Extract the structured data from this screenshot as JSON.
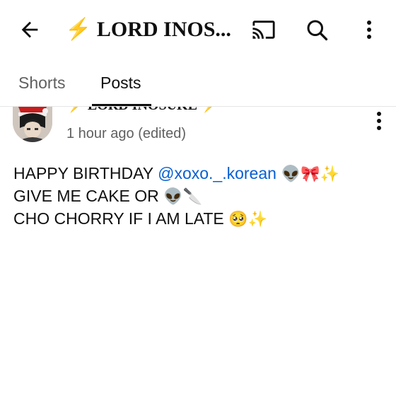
{
  "header": {
    "channel_title": "⚡ LORD INOS...",
    "icons": {
      "back": "arrow-back-icon",
      "cast": "cast-icon",
      "search": "search-icon",
      "more": "more-vertical-icon"
    }
  },
  "tabs": [
    {
      "label": "Shorts",
      "selected": false
    },
    {
      "label": "Posts",
      "selected": true
    }
  ],
  "post": {
    "author": "⚡ LORD INOSUKE ⚡",
    "timestamp": "1 hour ago (edited)",
    "lines": [
      {
        "text_before": "HAPPY BIRTHDAY ",
        "mention": "@xoxo._.korean",
        "emojis": " 👽🎀✨"
      },
      {
        "text_before": "GIVE ME CAKE OR ",
        "mention": "",
        "emojis": "👽🔪"
      },
      {
        "text_before": "CHO CHORRY IF I AM LATE ",
        "mention": "",
        "emojis": "🥺✨"
      }
    ]
  },
  "colors": {
    "mention": "#065fd4",
    "secondary_text": "#606060",
    "primary_text": "#0f0f0f"
  }
}
